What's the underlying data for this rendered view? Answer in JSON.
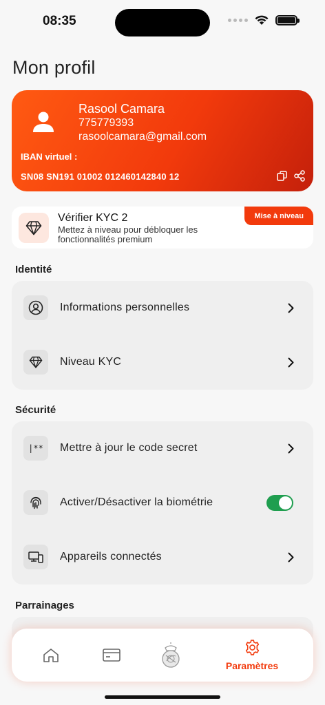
{
  "status_bar": {
    "time": "08:35"
  },
  "page": {
    "title": "Mon profil"
  },
  "profile": {
    "name": "Rasool Camara",
    "phone": "775779393",
    "email": "rasoolcamara@gmail.com",
    "iban_label": "IBAN virtuel :",
    "iban": "SN08 SN191 01002 012460142840 12"
  },
  "kyc_banner": {
    "title": "Vérifier KYC 2",
    "description": "Mettez à niveau pour débloquer les fonctionnalités premium",
    "upgrade_label": "Mise à niveau"
  },
  "sections": {
    "identity": {
      "title": "Identité",
      "items": [
        {
          "label": "Informations personnelles",
          "icon": "user-circle-icon"
        },
        {
          "label": "Niveau KYC",
          "icon": "diamond-icon"
        }
      ]
    },
    "security": {
      "title": "Sécurité",
      "items": [
        {
          "label": "Mettre à jour le code secret",
          "icon": "password-icon",
          "icon_text": "|**"
        },
        {
          "label": "Activer/Désactiver la biométrie",
          "icon": "fingerprint-icon",
          "toggle_on": true
        },
        {
          "label": "Appareils connectés",
          "icon": "devices-icon"
        }
      ]
    },
    "referrals": {
      "title": "Parrainages"
    }
  },
  "tab_bar": {
    "tabs": [
      {
        "icon": "home-icon",
        "label": ""
      },
      {
        "icon": "card-icon",
        "label": ""
      },
      {
        "icon": "club-crest-icon",
        "label": ""
      },
      {
        "icon": "gear-icon",
        "label": "Paramètres",
        "active": true
      }
    ]
  },
  "colors": {
    "accent": "#f23a0c",
    "toggle_on": "#1f9e4f",
    "card_bg": "#efefef"
  }
}
